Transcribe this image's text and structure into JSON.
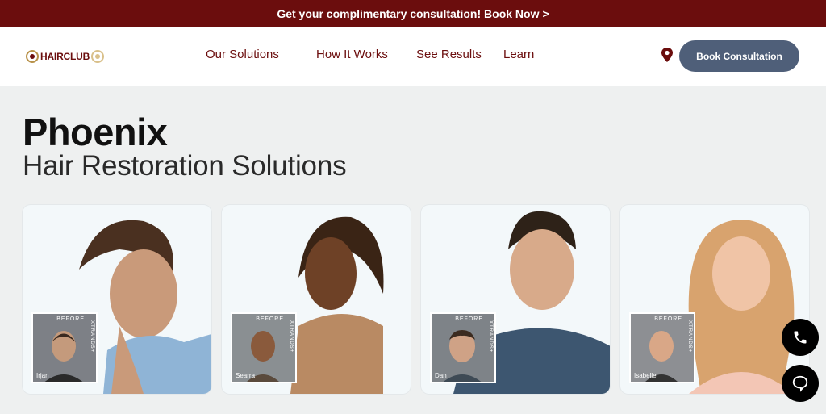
{
  "promo": {
    "text": "Get your complimentary consultation! Book Now",
    "arrow": ">"
  },
  "header": {
    "logo_text": "HAIRCLUB",
    "nav": [
      "Our Solutions",
      "How It Works",
      "See Results",
      "Learn"
    ],
    "book_button": "Book Consultation"
  },
  "hero": {
    "title": "Phoenix",
    "subtitle": "Hair Restoration Solutions"
  },
  "cards": [
    {
      "before_label": "BEFORE",
      "brand": "XTRANDS+",
      "name": "Irjan"
    },
    {
      "before_label": "BEFORE",
      "brand": "XTRANDS+",
      "name": "Searra"
    },
    {
      "before_label": "BEFORE",
      "brand": "XTRANDS+",
      "name": "Dan"
    },
    {
      "before_label": "BEFORE",
      "brand": "XTRANDS+",
      "name": "Isabelle"
    }
  ],
  "colors": {
    "brand": "#6b0d0d",
    "button": "#4f5f79",
    "background": "#eef0f0"
  },
  "icons": [
    "location-pin-icon",
    "phone-icon",
    "chat-icon"
  ]
}
